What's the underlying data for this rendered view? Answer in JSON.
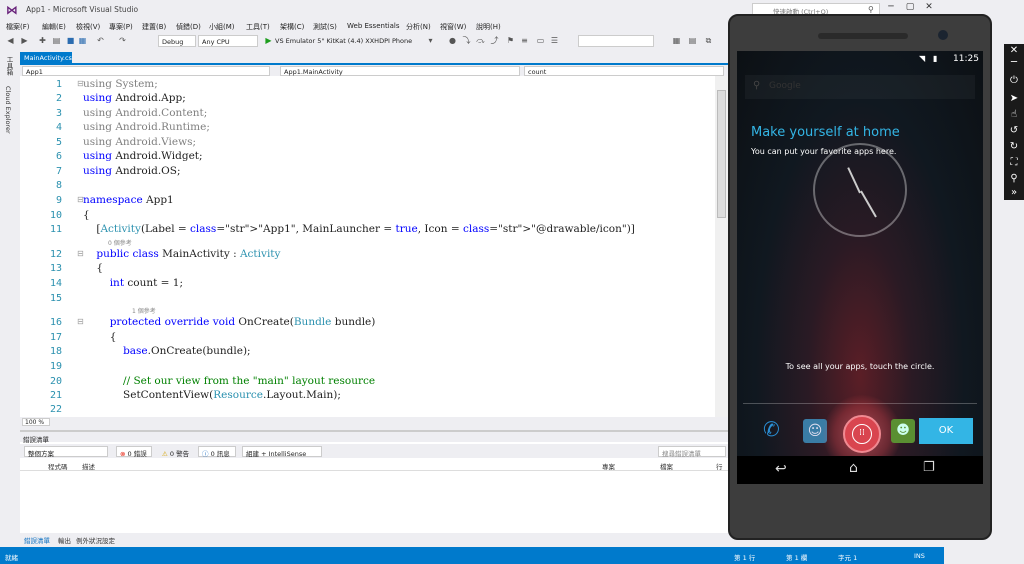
{
  "window": {
    "title": "App1 - Microsoft Visual Studio",
    "quick_launch": "快速啟動 (Ctrl+Q)",
    "notif_count": "1"
  },
  "menu": [
    "檔案(F)",
    "編輯(E)",
    "檢視(V)",
    "專案(P)",
    "建置(B)",
    "偵錯(D)",
    "小組(M)",
    "工具(T)",
    "架構(C)",
    "測試(S)",
    "Web Essentials",
    "分析(N)",
    "視窗(W)",
    "說明(H)"
  ],
  "toolbar": {
    "config": "Debug",
    "platform": "Any CPU",
    "run_target": "VS Emulator 5\" KitKat (4.4) XXHDPI Phone"
  },
  "side_panels": [
    "工具箱",
    "Cloud Explorer"
  ],
  "document": {
    "tab": "MainActivity.cs",
    "nav_project": "App1",
    "nav_class": "App1.MainActivity",
    "nav_member": "count",
    "zoom": "100 %"
  },
  "code": [
    {
      "n": "1",
      "t": "using System;",
      "dim": true
    },
    {
      "n": "2",
      "t": "using Android.App;"
    },
    {
      "n": "3",
      "t": "using Android.Content;",
      "dim": true
    },
    {
      "n": "4",
      "t": "using Android.Runtime;",
      "dim": true
    },
    {
      "n": "5",
      "t": "using Android.Views;",
      "dim": true
    },
    {
      "n": "6",
      "t": "using Android.Widget;"
    },
    {
      "n": "7",
      "t": "using Android.OS;"
    },
    {
      "n": "8",
      "t": ""
    },
    {
      "n": "9",
      "t": "namespace App1"
    },
    {
      "n": "10",
      "t": "{"
    },
    {
      "n": "11",
      "t": "    [Activity(Label = \"App1\", MainLauncher = true, Icon = \"@drawable/icon\")]"
    },
    {
      "n": "12",
      "t": "    public class MainActivity : Activity"
    },
    {
      "n": "13",
      "t": "    {"
    },
    {
      "n": "14",
      "t": "        int count = 1;"
    },
    {
      "n": "15",
      "t": ""
    },
    {
      "n": "16",
      "t": "        protected override void OnCreate(Bundle bundle)"
    },
    {
      "n": "17",
      "t": "        {"
    },
    {
      "n": "18",
      "t": "            base.OnCreate(bundle);"
    },
    {
      "n": "19",
      "t": ""
    },
    {
      "n": "20",
      "t": "            // Set our view from the \"main\" layout resource"
    },
    {
      "n": "21",
      "t": "            SetContentView(Resource.Layout.Main);"
    },
    {
      "n": "22",
      "t": ""
    }
  ],
  "refs": {
    "class_refs": "0 個參考",
    "method_refs": "1 個參考"
  },
  "error_list": {
    "title": "錯誤清單",
    "scope": "整個方案",
    "errors": "0 錯誤",
    "warnings": "0 警告",
    "messages": "0 訊息",
    "build": "組建 + IntelliSense",
    "search": "搜尋錯誤清單",
    "columns": [
      "程式碼",
      "描述",
      "專案",
      "檔案",
      "行"
    ],
    "tabs": [
      "錯誤清單",
      "輸出",
      "例外狀況設定"
    ]
  },
  "status": {
    "ready": "就緒",
    "line": "第 1 行",
    "col": "第 1 欄",
    "char": "字元 1",
    "mode": "INS"
  },
  "phone": {
    "time": "11:25",
    "search_hint": "Google",
    "welcome_title": "Make yourself at home",
    "welcome_sub": "You can put your favorite apps here.",
    "circle_hint": "To see all your apps, touch the circle.",
    "ok": "OK",
    "accent": "#33b5e5"
  }
}
